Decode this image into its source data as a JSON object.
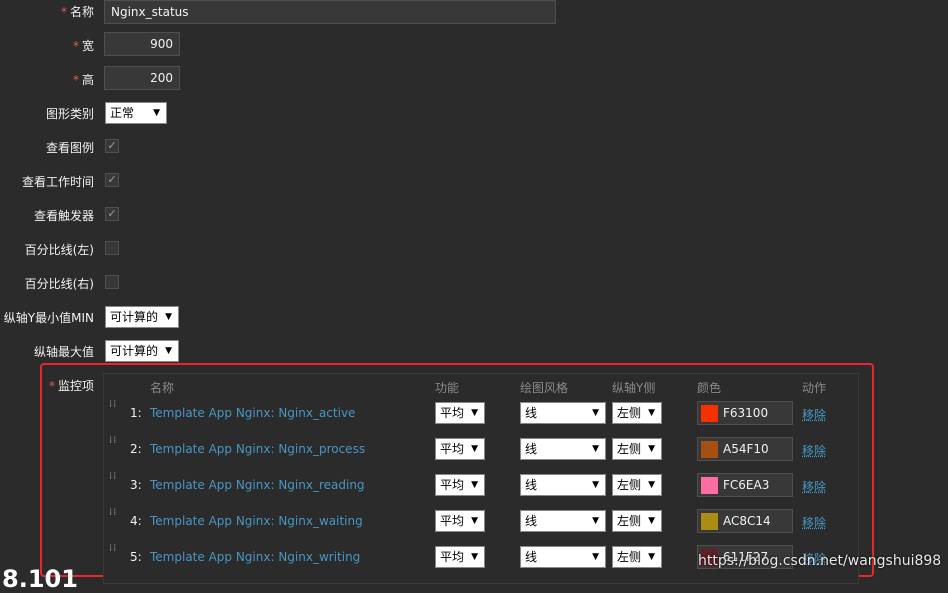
{
  "form": {
    "name": {
      "label": "名称",
      "value": "Nginx_status"
    },
    "width": {
      "label": "宽",
      "value": "900"
    },
    "height": {
      "label": "高",
      "value": "200"
    },
    "graph_type": {
      "label": "图形类别",
      "value": "正常"
    },
    "show_legend": {
      "label": "查看图例",
      "checked": true
    },
    "show_work_period": {
      "label": "查看工作时间",
      "checked": true
    },
    "show_triggers": {
      "label": "查看触发器",
      "checked": true
    },
    "percentile_left": {
      "label": "百分比线(左)",
      "checked": false
    },
    "percentile_right": {
      "label": "百分比线(右)",
      "checked": false
    },
    "ymin": {
      "label": "纵轴Y最小值MIN",
      "value": "可计算的"
    },
    "ymax": {
      "label": "纵轴最大值",
      "value": "可计算的"
    },
    "required_mark": "*"
  },
  "items": {
    "label": "监控项",
    "headers": {
      "name": "名称",
      "function": "功能",
      "draw_style": "绘图风格",
      "y_axis": "纵轴Y侧",
      "color": "颜色",
      "action": "动作"
    },
    "rows": [
      {
        "idx": "1:",
        "name": "Template App Nginx: Nginx_active",
        "function": "平均",
        "draw_style": "线",
        "y_axis": "左侧",
        "color": "F63100",
        "color_hex": "#F63100",
        "action": "移除"
      },
      {
        "idx": "2:",
        "name": "Template App Nginx: Nginx_process",
        "function": "平均",
        "draw_style": "线",
        "y_axis": "左侧",
        "color": "A54F10",
        "color_hex": "#A54F10",
        "action": "移除"
      },
      {
        "idx": "3:",
        "name": "Template App Nginx: Nginx_reading",
        "function": "平均",
        "draw_style": "线",
        "y_axis": "左侧",
        "color": "FC6EA3",
        "color_hex": "#FC6EA3",
        "action": "移除"
      },
      {
        "idx": "4:",
        "name": "Template App Nginx: Nginx_waiting",
        "function": "平均",
        "draw_style": "线",
        "y_axis": "左侧",
        "color": "AC8C14",
        "color_hex": "#AC8C14",
        "action": "移除"
      },
      {
        "idx": "5:",
        "name": "Template App Nginx: Nginx_writing",
        "function": "平均",
        "draw_style": "线",
        "y_axis": "左侧",
        "color": "611F27",
        "color_hex": "#611F27",
        "action": "移除"
      }
    ]
  },
  "watermark": "https://blog.csdn.net/wangshui898",
  "partial_text": "8.101"
}
